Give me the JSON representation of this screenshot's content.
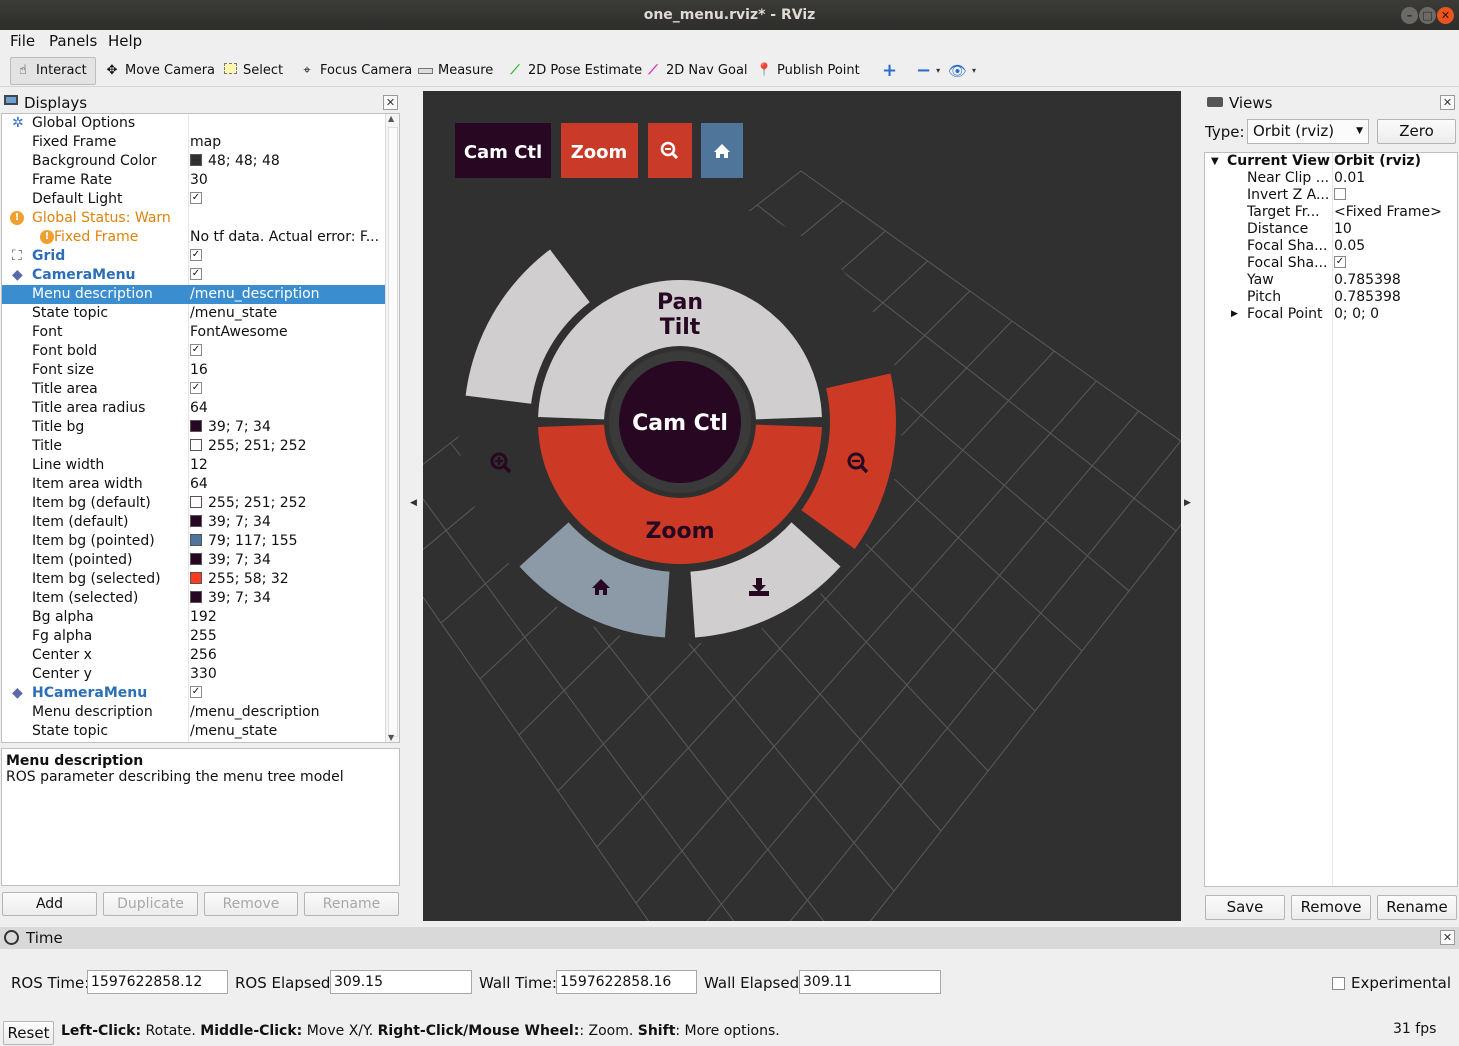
{
  "window": {
    "title": "one_menu.rviz* - RViz"
  },
  "menubar": [
    "File",
    "Panels",
    "Help"
  ],
  "toolbar": {
    "tools": [
      {
        "label": "Interact",
        "icon": "pointer-icon"
      },
      {
        "label": "Move Camera",
        "icon": "move-icon"
      },
      {
        "label": "Select",
        "icon": "select-icon"
      },
      {
        "label": "Focus Camera",
        "icon": "focus-icon"
      },
      {
        "label": "Measure",
        "icon": "ruler-icon"
      },
      {
        "label": "2D Pose Estimate",
        "icon": "green-arrow-icon"
      },
      {
        "label": "2D Nav Goal",
        "icon": "pink-arrow-icon"
      },
      {
        "label": "Publish Point",
        "icon": "pin-icon"
      }
    ]
  },
  "displays": {
    "title": "Displays",
    "rows": [
      {
        "name": "Global Options",
        "value": ""
      },
      {
        "name": "Fixed Frame",
        "value": "map"
      },
      {
        "name": "Background Color",
        "value": "48; 48; 48",
        "color": "#303030"
      },
      {
        "name": "Frame Rate",
        "value": "30"
      },
      {
        "name": "Default Light",
        "value": "✓"
      },
      {
        "name": "Global Status: Warn",
        "value": ""
      },
      {
        "name": "Fixed Frame",
        "value": "No tf data.  Actual error: F..."
      },
      {
        "name": "Grid",
        "value": "✓"
      },
      {
        "name": "CameraMenu",
        "value": "✓"
      },
      {
        "name": "Menu description",
        "value": "/menu_description"
      },
      {
        "name": "State topic",
        "value": "/menu_state"
      },
      {
        "name": "Font",
        "value": "FontAwesome"
      },
      {
        "name": "Font bold",
        "value": "✓"
      },
      {
        "name": "Font size",
        "value": "16"
      },
      {
        "name": "Title area",
        "value": "✓"
      },
      {
        "name": "Title area radius",
        "value": "64"
      },
      {
        "name": "Title bg",
        "value": "39; 7; 34",
        "color": "#270722"
      },
      {
        "name": "Title",
        "value": "255; 251; 252",
        "color": "#fffbfc"
      },
      {
        "name": "Line width",
        "value": "12"
      },
      {
        "name": "Item area width",
        "value": "64"
      },
      {
        "name": "Item bg (default)",
        "value": "255; 251; 252",
        "color": "#fffbfc"
      },
      {
        "name": "Item (default)",
        "value": "39; 7; 34",
        "color": "#270722"
      },
      {
        "name": "Item bg (pointed)",
        "value": "79; 117; 155",
        "color": "#4f759b"
      },
      {
        "name": "Item (pointed)",
        "value": "39; 7; 34",
        "color": "#270722"
      },
      {
        "name": "Item bg (selected)",
        "value": "255; 58; 32",
        "color": "#ff3a20"
      },
      {
        "name": "Item (selected)",
        "value": "39; 7; 34",
        "color": "#270722"
      },
      {
        "name": "Bg alpha",
        "value": "192"
      },
      {
        "name": "Fg alpha",
        "value": "255"
      },
      {
        "name": "Center x",
        "value": "256"
      },
      {
        "name": "Center y",
        "value": "330"
      },
      {
        "name": "HCameraMenu",
        "value": "✓"
      },
      {
        "name": "Menu description",
        "value": "/menu_description"
      },
      {
        "name": "State topic",
        "value": "/menu_state"
      }
    ],
    "description_title": "Menu description",
    "description_text": "ROS parameter describing the menu tree model",
    "buttons": [
      "Add",
      "Duplicate",
      "Remove",
      "Rename"
    ]
  },
  "viewport": {
    "hmenu": [
      "Cam Ctl",
      "Zoom"
    ],
    "hmenu_colors": {
      "title": "#270722",
      "selected": "#c93b28",
      "pointed": "#4f759b"
    },
    "radial": {
      "center_label": "Cam Ctl",
      "pan_tilt_line1": "Pan",
      "pan_tilt_line2": "Tilt",
      "zoom_label": "Zoom",
      "item_colors": {
        "default": "#d0cecf",
        "selected": "#cc3a26",
        "pointed": "#8c9aa8",
        "title": "#270722"
      }
    }
  },
  "views": {
    "title": "Views",
    "type_label": "Type:",
    "type_value": "Orbit (rviz)",
    "zero_label": "Zero",
    "current_view": {
      "name": "Current View",
      "value": "Orbit (rviz)"
    },
    "props": [
      {
        "name": "Near Clip ...",
        "value": "0.01"
      },
      {
        "name": "Invert Z A...",
        "value": ""
      },
      {
        "name": "Target Fr...",
        "value": "<Fixed Frame>"
      },
      {
        "name": "Distance",
        "value": "10"
      },
      {
        "name": "Focal Sha...",
        "value": "0.05"
      },
      {
        "name": "Focal Sha...",
        "value": "✓"
      },
      {
        "name": "Yaw",
        "value": "0.785398"
      },
      {
        "name": "Pitch",
        "value": "0.785398"
      },
      {
        "name": "Focal Point",
        "value": "0; 0; 0"
      }
    ],
    "buttons": [
      "Save",
      "Remove",
      "Rename"
    ]
  },
  "time": {
    "title": "Time",
    "ros_time_label": "ROS Time:",
    "ros_time": "1597622858.12",
    "ros_elapsed_label": "ROS Elapsed:",
    "ros_elapsed": "309.15",
    "wall_time_label": "Wall Time:",
    "wall_time": "1597622858.16",
    "wall_elapsed_label": "Wall Elapsed:",
    "wall_elapsed": "309.11",
    "experimental": "Experimental"
  },
  "status": {
    "reset": "Reset",
    "k1": "Left-Click:",
    "v1": " Rotate. ",
    "k2": "Middle-Click:",
    "v2": " Move X/Y. ",
    "k3": "Right-Click/Mouse Wheel:",
    "v3": ": Zoom. ",
    "k4": "Shift",
    "v4": ": More options.",
    "fps": "31 fps"
  }
}
